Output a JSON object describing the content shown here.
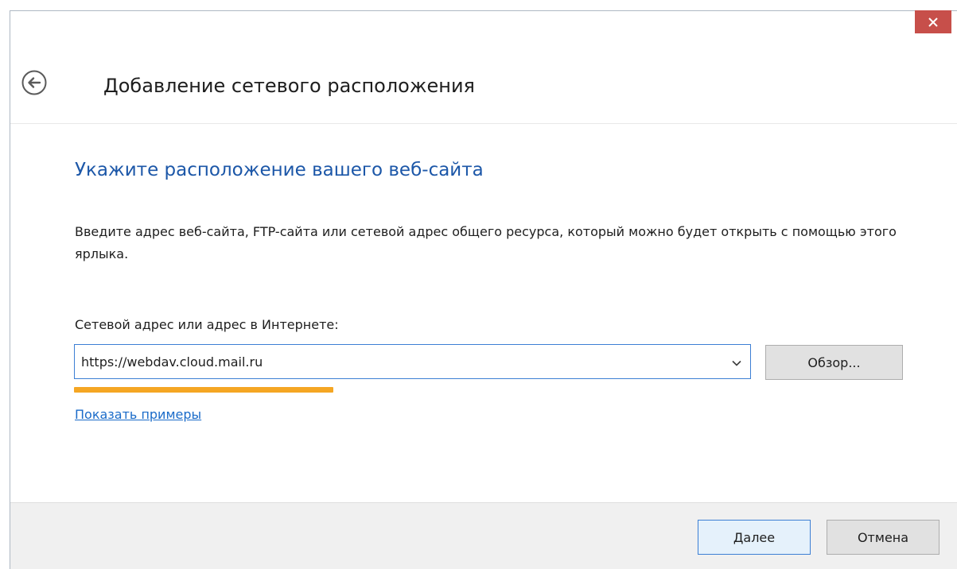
{
  "window": {
    "close_label": "×",
    "close_icon": "close-icon",
    "back_icon": "back-arrow-icon"
  },
  "dialog": {
    "title": "Добавление сетевого расположения",
    "heading": "Укажите расположение вашего веб-сайта",
    "instructions": "Введите адрес веб-сайта, FTP-сайта или сетевой адрес общего ресурса, который можно будет открыть с помощью этого ярлыка.",
    "address_label": "Сетевой адрес или адрес в Интернете:",
    "address_value": "https://webdav.cloud.mail.ru",
    "browse_label": "Обзор...",
    "examples_link": "Показать примеры"
  },
  "footer": {
    "next_label": "Далее",
    "cancel_label": "Отмена"
  },
  "colors": {
    "heading": "#1c57a8",
    "link": "#1a6bc9",
    "close_bg": "#c74f4a",
    "highlight": "#f5a623",
    "focus_border": "#3c7fd4"
  }
}
